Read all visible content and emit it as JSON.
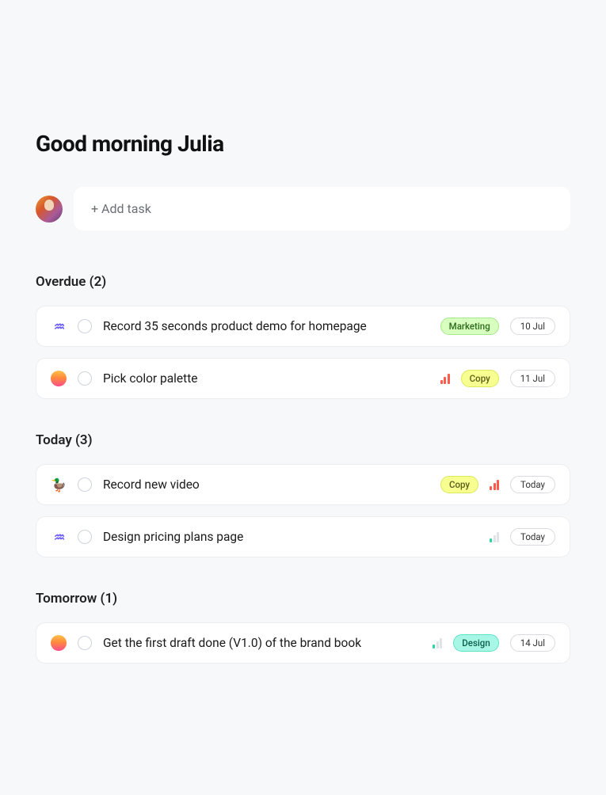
{
  "greeting": "Good morning Julia",
  "addTask": {
    "placeholder": "+ Add task"
  },
  "sections": [
    {
      "title": "Overdue (2)",
      "tasks": [
        {
          "project": "wave",
          "title": "Record 35 seconds product demo for homepage",
          "priority": null,
          "tag": {
            "label": "Marketing",
            "cls": "marketing"
          },
          "date": "10 Jul"
        },
        {
          "project": "sun",
          "title": "Pick color palette",
          "priority": "high",
          "tag": {
            "label": "Copy",
            "cls": "copy"
          },
          "date": "11 Jul"
        }
      ]
    },
    {
      "title": "Today (3)",
      "tasks": [
        {
          "project": "duck",
          "title": "Record new video",
          "priority": "high",
          "tag": {
            "label": "Copy",
            "cls": "copy"
          },
          "date": "Today"
        },
        {
          "project": "wave",
          "title": "Design pricing plans page",
          "priority": "low",
          "tag": null,
          "date": "Today"
        }
      ]
    },
    {
      "title": "Tomorrow (1)",
      "tasks": [
        {
          "project": "sun",
          "title": "Get the first draft done (V1.0) of the brand book",
          "priority": "low",
          "tag": {
            "label": "Design",
            "cls": "design"
          },
          "date": "14 Jul"
        }
      ]
    }
  ]
}
